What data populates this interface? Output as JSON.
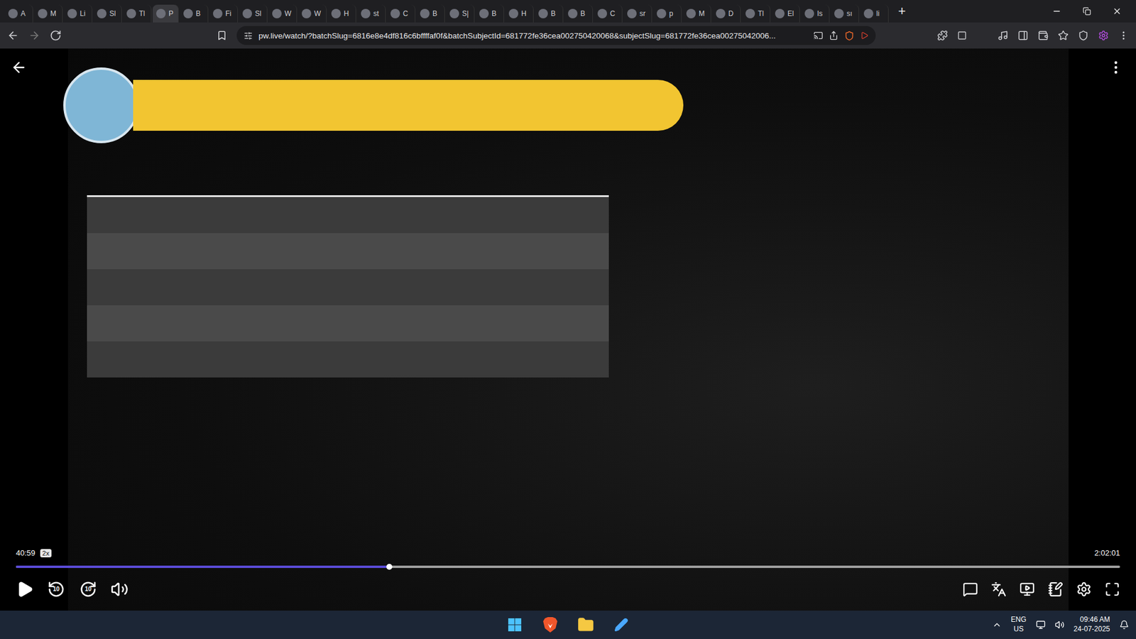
{
  "browser": {
    "tabs": [
      {
        "label": "A",
        "selected": false
      },
      {
        "label": "M",
        "selected": false
      },
      {
        "label": "Li",
        "selected": false
      },
      {
        "label": "Sl",
        "selected": false
      },
      {
        "label": "Tl",
        "selected": false
      },
      {
        "label": "P",
        "selected": true
      },
      {
        "label": "B",
        "selected": false
      },
      {
        "label": "Fi",
        "selected": false
      },
      {
        "label": "Sl",
        "selected": false
      },
      {
        "label": "W",
        "selected": false
      },
      {
        "label": "W",
        "selected": false
      },
      {
        "label": "H",
        "selected": false
      },
      {
        "label": "st",
        "selected": false
      },
      {
        "label": "C",
        "selected": false
      },
      {
        "label": "B",
        "selected": false
      },
      {
        "label": "S|",
        "selected": false
      },
      {
        "label": "B",
        "selected": false
      },
      {
        "label": "H",
        "selected": false
      },
      {
        "label": "B",
        "selected": false
      },
      {
        "label": "B",
        "selected": false
      },
      {
        "label": "C",
        "selected": false
      },
      {
        "label": "sr",
        "selected": false
      },
      {
        "label": "p",
        "selected": false
      },
      {
        "label": "M",
        "selected": false
      },
      {
        "label": "D",
        "selected": false
      },
      {
        "label": "Tl",
        "selected": false
      },
      {
        "label": "El",
        "selected": false
      },
      {
        "label": "Is",
        "selected": false
      },
      {
        "label": "sı",
        "selected": false
      },
      {
        "label": "li",
        "selected": false
      }
    ],
    "new_tab": "+",
    "url": "pw.live/watch/?batchSlug=6816e8e4df816c6bffffaf0f&batchSubjectId=681772fe36cea002750420068&subjectSlug=681772fe36cea00275042006..."
  },
  "player": {
    "current_time": "40:59",
    "speed": "2x",
    "duration": "2:02:01",
    "progress": {
      "level": 0.338
    },
    "playing": false,
    "rewind_label": "10",
    "forward_label": "10"
  },
  "taskbar": {
    "language": "ENG",
    "region": "US",
    "time": "09:46 AM",
    "date": "24-07-2025"
  }
}
